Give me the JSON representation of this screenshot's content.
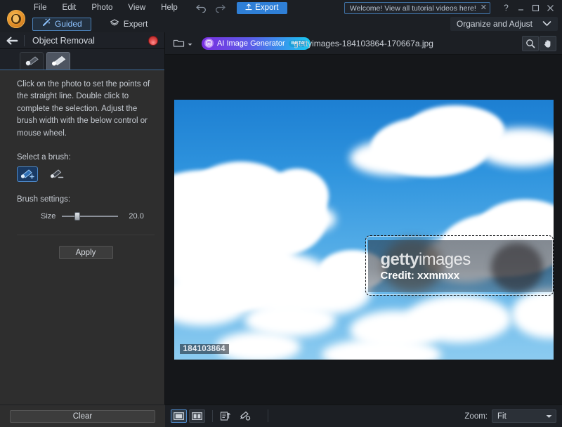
{
  "app": {
    "logo_icon": "photo-editor-logo",
    "menu": [
      "File",
      "Edit",
      "Photo",
      "View",
      "Help"
    ],
    "undo_icon": "undo-arrow-icon",
    "redo_icon": "redo-arrow-icon",
    "export_label": "Export",
    "export_icon": "upload-icon",
    "export_color": "#2f7fd6"
  },
  "notification": {
    "text": "Welcome! View all tutorial videos here!",
    "close_icon": "close-icon"
  },
  "window_controls": {
    "help_icon": "question-mark-icon",
    "minimize_icon": "minimize-icon",
    "maximize_icon": "maximize-icon",
    "close_icon": "close-icon"
  },
  "modes": {
    "guided": {
      "label": "Guided",
      "icon": "magic-wand-icon",
      "active": true
    },
    "expert": {
      "label": "Expert",
      "icon": "layers-icon",
      "active": false
    },
    "organize_label": "Organize and Adjust",
    "organize_caret": "chevron-down-icon"
  },
  "sidebar": {
    "back_icon": "back-arrow-icon",
    "title": "Object Removal",
    "close_icon": "red-close-icon",
    "tabs": [
      {
        "name": "brush-tool-tab",
        "icon": "brush-round-icon",
        "active": false
      },
      {
        "name": "line-tool-tab",
        "icon": "brush-line-icon",
        "active": true
      }
    ],
    "instructions": "Click on the photo to set the points of the straight line. Double click to complete the selection. Adjust the brush width with the below control or mouse wheel.",
    "brush_section_label": "Select a brush:",
    "brush_options": [
      {
        "name": "add-brush",
        "icon": "brush-plus-icon",
        "selected": true
      },
      {
        "name": "subtract-brush",
        "icon": "brush-minus-icon",
        "selected": false
      }
    ],
    "settings_label": "Brush settings:",
    "size_label": "Size",
    "size_value": "20.0",
    "apply_label": "Apply",
    "clear_label": "Clear"
  },
  "canvas": {
    "folder_icon": "folder-icon",
    "folder_caret": "caret-down-icon",
    "ai_button": {
      "label": "AI Image Generator",
      "badge": "BETA",
      "icon": "ai-image-icon"
    },
    "file_name": "gettyimages-184103864-170667a.jpg",
    "zoom_tool_icon": "magnifier-icon",
    "hand_tool_icon": "hand-icon"
  },
  "photo": {
    "id_badge": "184103864",
    "watermark_main_bold": "getty",
    "watermark_main_light": "images",
    "watermark_credit": "Credit: xxmmxx",
    "selection_name": "dashed-selection-region"
  },
  "bottom_bar": {
    "view_single_icon": "single-view-icon",
    "view_split_icon": "split-view-icon",
    "view_single_active": true,
    "reset_icon": "reset-panels-icon",
    "tool_options_icon": "tool-options-icon",
    "zoom_label": "Zoom:",
    "zoom_value": "Fit",
    "zoom_caret": "caret-down-icon"
  },
  "colors": {
    "accent_blue": "#2f7fd6",
    "panel_bg": "#2e2e2e",
    "chrome_bg": "#1c1f24",
    "selection_blue": "#4e89c9"
  }
}
